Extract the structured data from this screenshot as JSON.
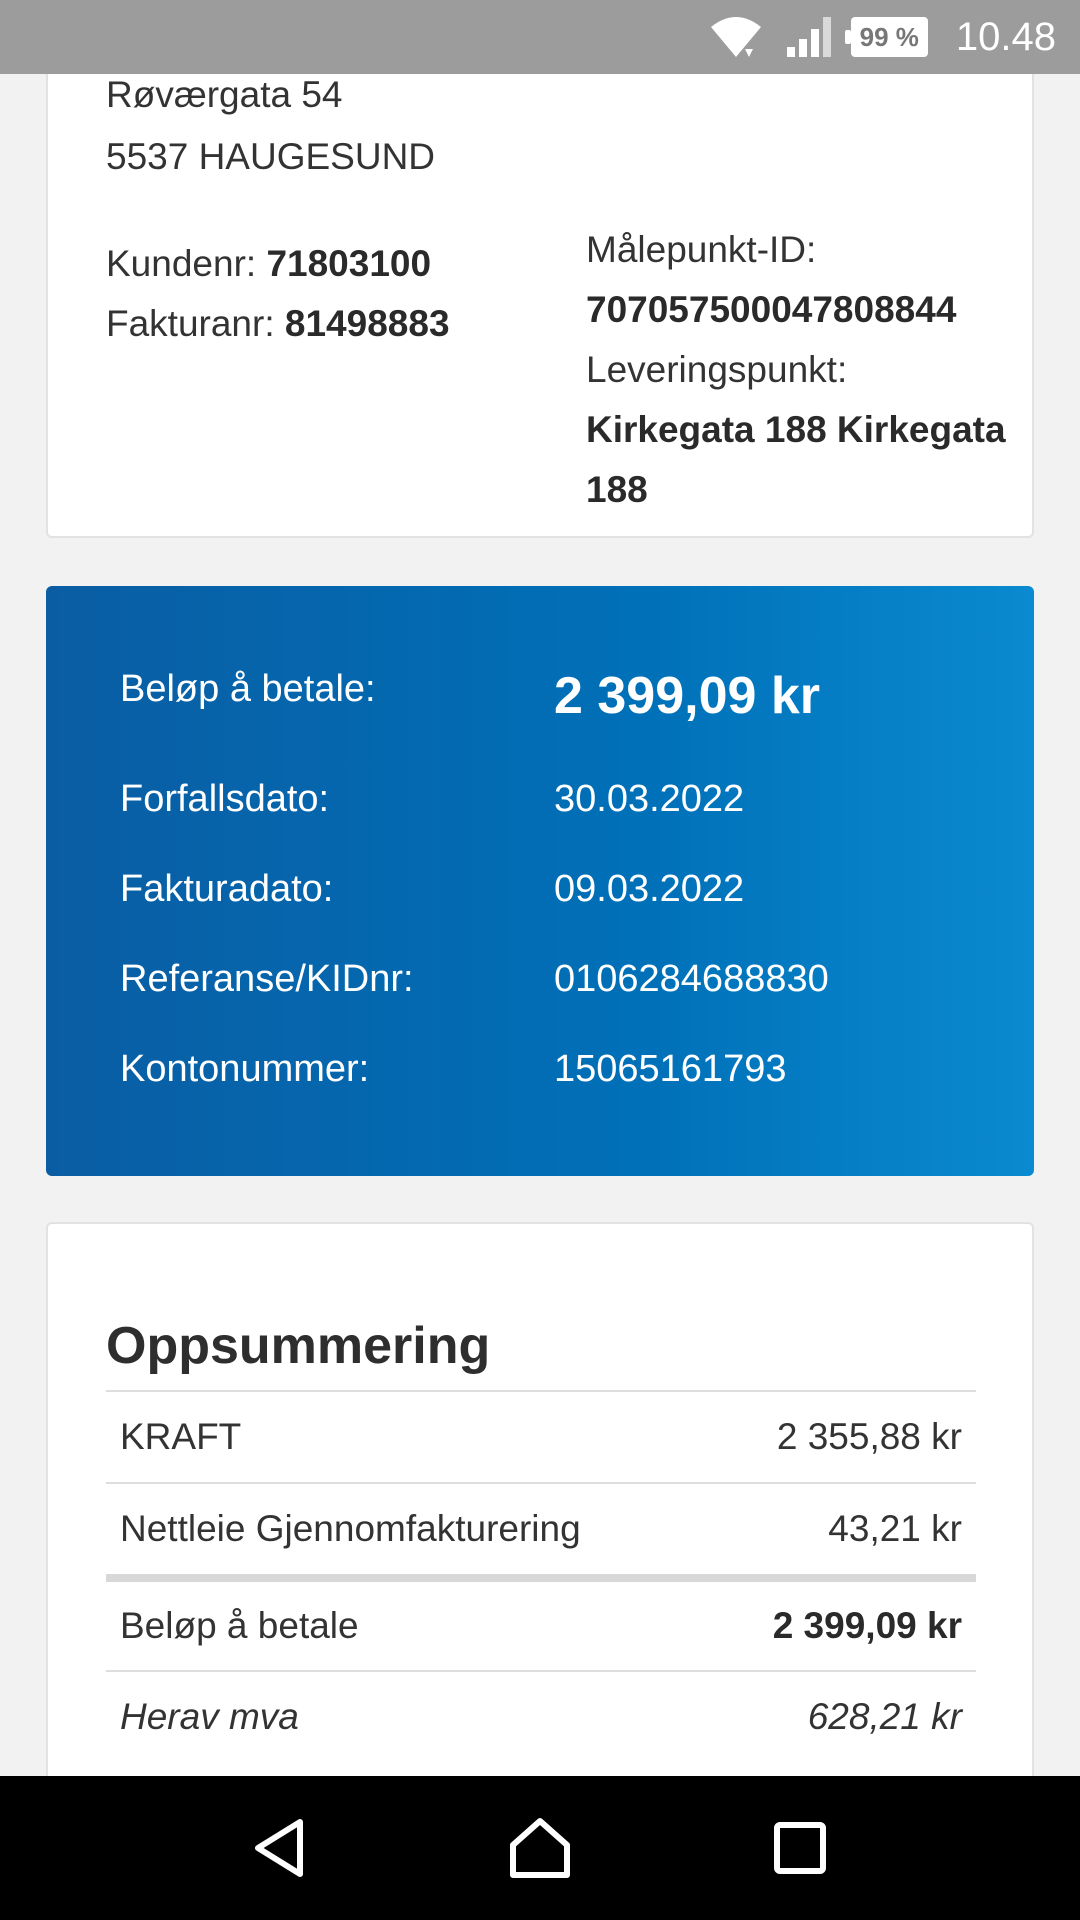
{
  "status_bar": {
    "battery": "99 %",
    "time": "10.48",
    "icons": [
      "wifi-icon",
      "signal-icon",
      "battery-icon"
    ]
  },
  "customer": {
    "street": "Røværgata 54",
    "postal": "5537 HAUGESUND",
    "kundenr_label": "Kundenr:",
    "kundenr_value": "71803100",
    "fakturanr_label": "Fakturanr:",
    "fakturanr_value": "81498883",
    "malepunkt_label": "Målepunkt-ID:",
    "malepunkt_value": "707057500047808844",
    "leveringspunkt_label": "Leveringspunkt:",
    "leveringspunkt_value": "Kirkegata 188 Kirkegata 188"
  },
  "payment": {
    "amount_label": "Beløp å betale:",
    "amount_value": "2 399,09 kr",
    "due_label": "Forfallsdato:",
    "due_value": "30.03.2022",
    "invoice_date_label": "Fakturadato:",
    "invoice_date_value": "09.03.2022",
    "reference_label": "Referanse/KIDnr:",
    "reference_value": "0106284688830",
    "account_label": "Kontonummer:",
    "account_value": "15065161793"
  },
  "summary": {
    "title": "Oppsummering",
    "rows": [
      {
        "label": "KRAFT",
        "value": "2 355,88 kr"
      },
      {
        "label": "Nettleie Gjennomfakturering",
        "value": "43,21 kr"
      }
    ],
    "total_label": "Beløp å betale",
    "total_value": "2 399,09 kr",
    "vat_label": "Herav mva",
    "vat_value": "628,21 kr"
  },
  "colors": {
    "pay_gradient_start": "#0a5da3",
    "pay_gradient_end": "#0a8ad0",
    "status_bar": "#9c9c9c",
    "nav_bar": "#000000"
  },
  "nav": {
    "icons": [
      "back-icon",
      "home-icon",
      "recents-icon"
    ]
  }
}
